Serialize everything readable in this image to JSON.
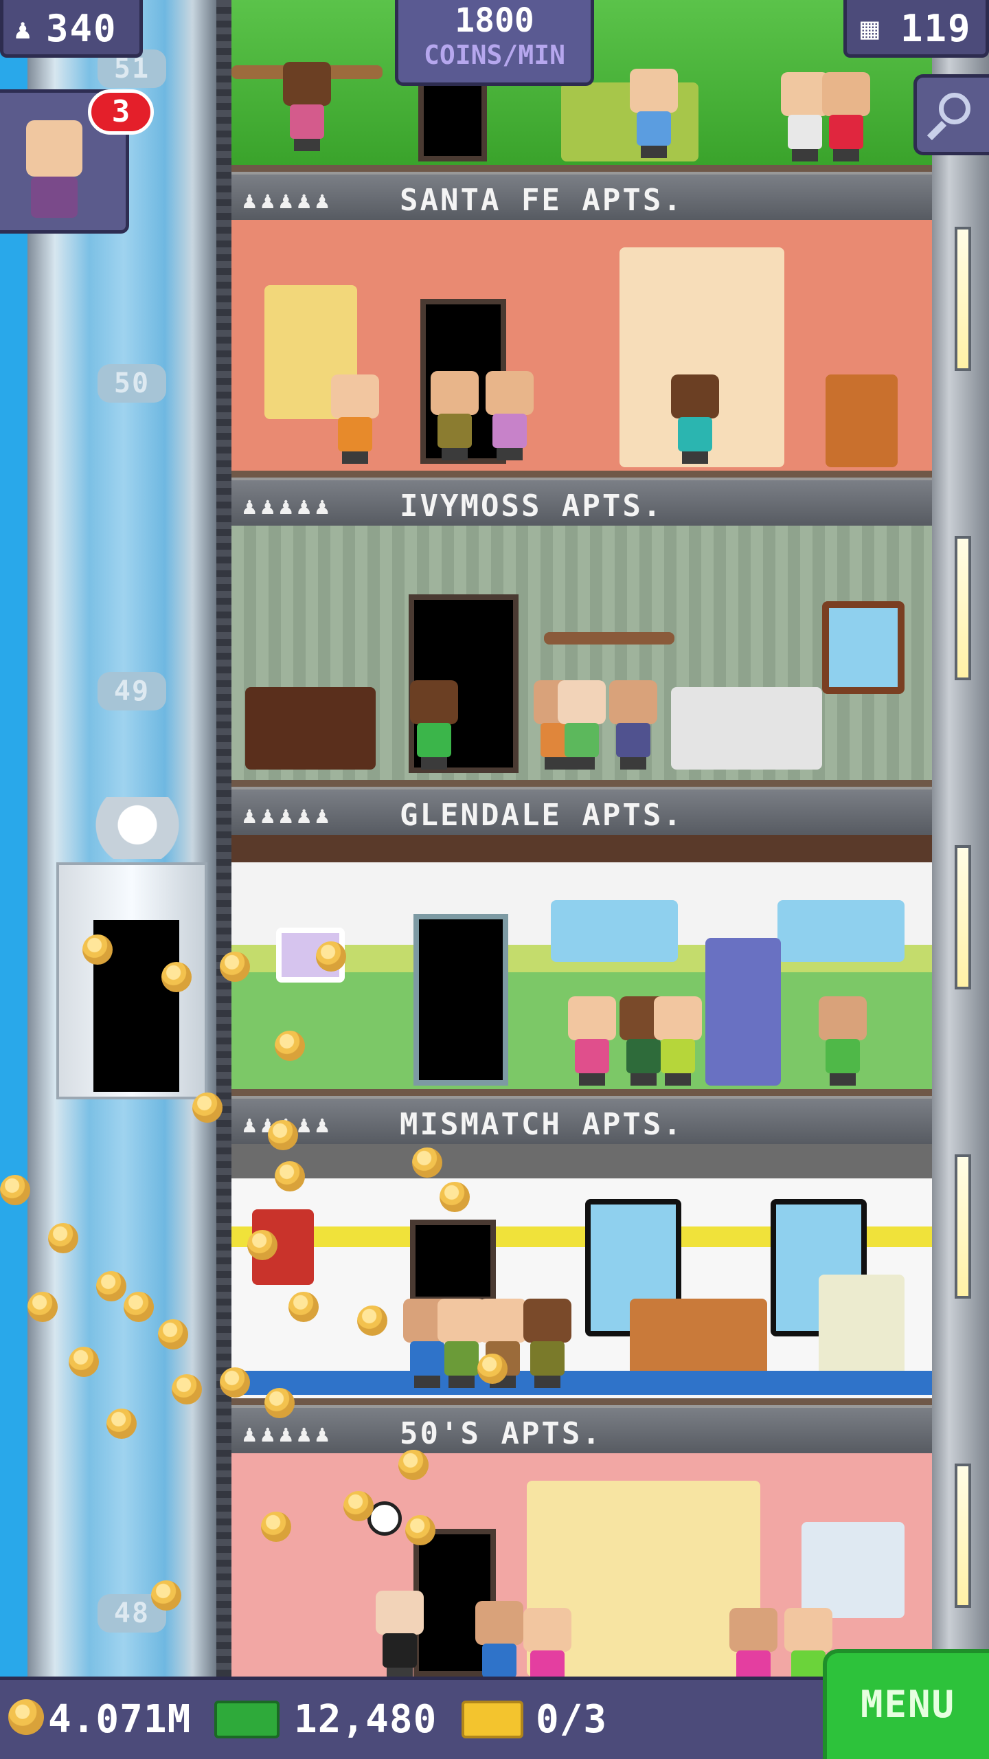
{
  "hud": {
    "population": "340",
    "coins_per_min_value": "1800",
    "coins_per_min_unit": "COINS/MIN",
    "floors": "119",
    "visitor_badge": "3"
  },
  "shaft_floor_labels": [
    "51",
    "50",
    "49",
    "48"
  ],
  "floors": [
    {
      "name": "SANTA FE APTS.",
      "residents_filled": 5,
      "residents_total": 5
    },
    {
      "name": "IVYMOSS APTS.",
      "residents_filled": 5,
      "residents_total": 5
    },
    {
      "name": "GLENDALE APTS.",
      "residents_filled": 5,
      "residents_total": 5
    },
    {
      "name": "MISMATCH APTS.",
      "residents_filled": 5,
      "residents_total": 5
    },
    {
      "name": "50'S APTS.",
      "residents_filled": 5,
      "residents_total": 5
    }
  ],
  "bottom": {
    "coins": "4.071M",
    "bux": "12,480",
    "tickets": "0/3",
    "menu_label": "MENU"
  },
  "colors": {
    "hud_bg": "#4c4b7a",
    "menu_bg": "#2dc23b",
    "badge": "#e41f2a",
    "coin": "#f3c24e"
  }
}
